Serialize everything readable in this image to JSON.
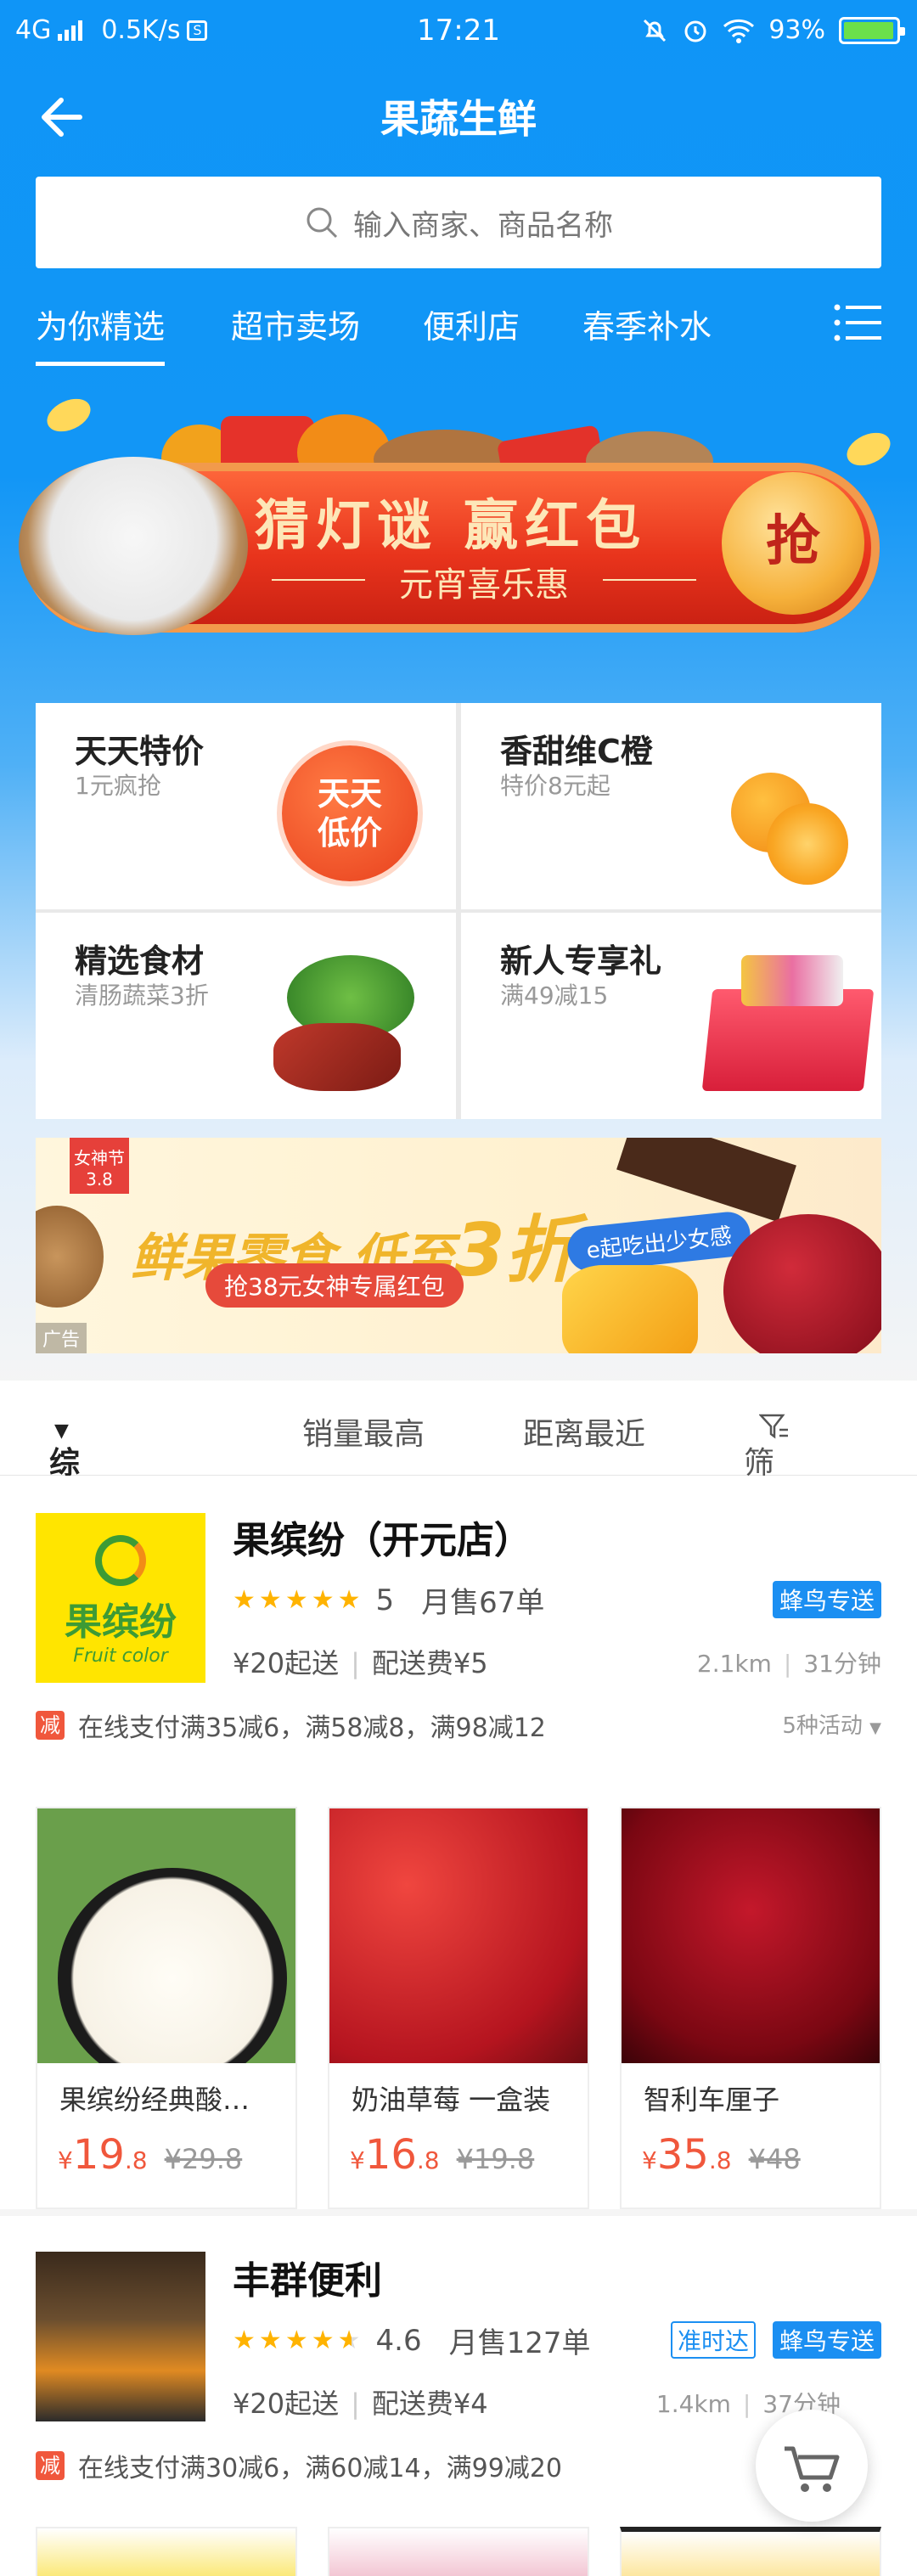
{
  "status_bar": {
    "network": "4G",
    "speed": "0.5K/s",
    "speed_icon": "S",
    "time": "17:21",
    "battery": "93%"
  },
  "header": {
    "title": "果蔬生鲜",
    "back_icon": "arrow-left-icon"
  },
  "search": {
    "placeholder": "输入商家、商品名称"
  },
  "tabs": [
    "为你精选",
    "超市卖场",
    "便利店",
    "春季补水"
  ],
  "banner": {
    "title": "猜灯谜  赢红包",
    "subtitle": "元宵喜乐惠",
    "button": "抢"
  },
  "categories": [
    {
      "title": "天天特价",
      "subtitle": "1元疯抢",
      "badge": "天天\n低价"
    },
    {
      "title": "香甜维C橙",
      "subtitle": "特价8元起"
    },
    {
      "title": "精选食材",
      "subtitle": "清肠蔬菜3折"
    },
    {
      "title": "新人专享礼",
      "subtitle": "满49减15"
    }
  ],
  "ad": {
    "headline": "鲜果零食 低至",
    "headline_big": "3折",
    "red_pill": "抢38元女神专属红包",
    "blue_pill": "e起吃出少女感",
    "tag_top": "女神节",
    "tag_top_sub": "3.8",
    "ad_label": "广告"
  },
  "sort_bar": [
    "综合排序",
    "销量最高",
    "距离最近",
    "筛选"
  ],
  "shops": [
    {
      "name": "果缤纷（开元店）",
      "logo_text": "果缤纷",
      "logo_sub": "Fruit color",
      "rating": 5,
      "rating_text": "5",
      "monthly_sales": "月售67单",
      "badges": [
        "蜂鸟专送"
      ],
      "min_order": "¥20起送",
      "delivery_fee": "配送费¥5",
      "distance": "2.1km",
      "time": "31分钟",
      "promo_tag": "减",
      "promo": "在线支付满35减6，满58减8，满98减12",
      "activities": "5种活动",
      "products": [
        {
          "name": "果缤纷经典酸…",
          "price_int": "19",
          "price_dec": ".8",
          "old_price": "¥29.8"
        },
        {
          "name": "奶油草莓 一盒装",
          "price_int": "16",
          "price_dec": ".8",
          "old_price": "¥19.8"
        },
        {
          "name": "智利车厘子",
          "price_int": "35",
          "price_dec": ".8",
          "old_price": "¥48"
        }
      ]
    },
    {
      "name": "丰群便利",
      "rating": 4.6,
      "rating_text": "4.6",
      "monthly_sales": "月售127单",
      "badges": [
        "准时达",
        "蜂鸟专送"
      ],
      "min_order": "¥20起送",
      "delivery_fee": "配送费¥4",
      "distance": "1.4km",
      "time": "37分钟",
      "promo_tag": "减",
      "promo": "在线支付满30减6，满60减14，满99减20"
    }
  ],
  "currency": "¥",
  "colors": {
    "primary": "#1296f6",
    "price": "#f0573c",
    "star": "#ffb300",
    "badge": "#1b8ff2"
  }
}
